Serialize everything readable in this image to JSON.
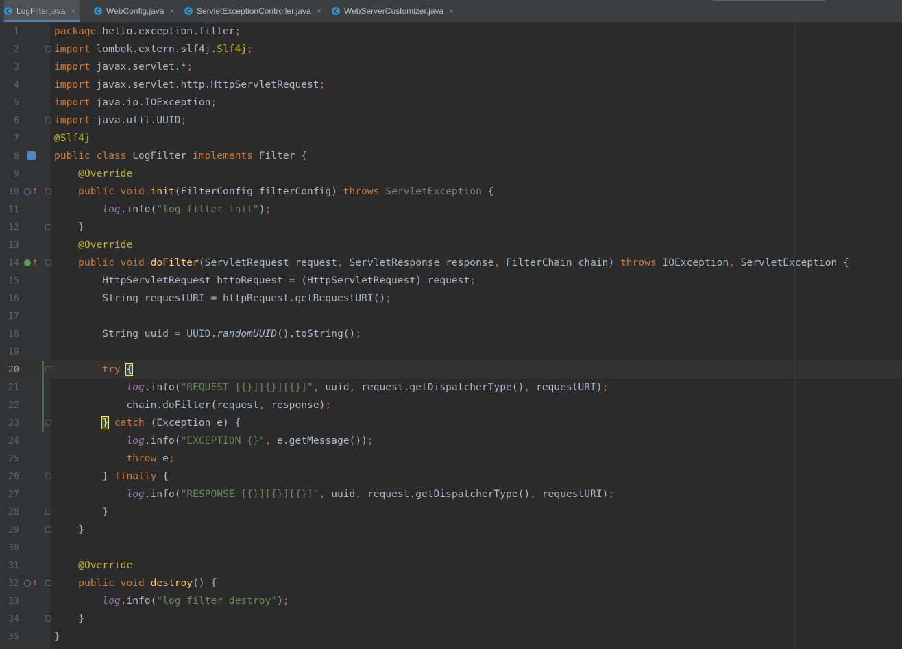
{
  "tabs": [
    {
      "label": "LogFilter.java",
      "active": true
    },
    {
      "label": "WebConfig.java",
      "active": false
    },
    {
      "label": "ServletExceptionController.java",
      "active": false
    },
    {
      "label": "WebServerCustomizer.java",
      "active": false
    }
  ],
  "tab_icon_letter": "C",
  "tab_close_glyph": "×",
  "current_line": 20,
  "colors": {
    "keyword": "#cc7832",
    "annotation": "#bbb529",
    "string": "#6a8759",
    "method": "#ffc66d",
    "field": "#9876aa",
    "default_text": "#a9b7c6",
    "background": "#2b2b2b",
    "gutter": "#313335"
  },
  "code_lines": [
    {
      "n": "1",
      "tokens": [
        [
          "k",
          "package"
        ],
        [
          "t",
          " hello.exception.filter"
        ],
        [
          "k",
          ";"
        ]
      ]
    },
    {
      "n": "2",
      "tokens": [
        [
          "k",
          "import"
        ],
        [
          "t",
          " lombok.extern.slf4j."
        ],
        [
          "ann",
          "Slf4j"
        ],
        [
          "k",
          ";"
        ]
      ]
    },
    {
      "n": "3",
      "tokens": [
        [
          "k",
          "import"
        ],
        [
          "t",
          " javax.servlet.*"
        ],
        [
          "k",
          ";"
        ]
      ]
    },
    {
      "n": "4",
      "tokens": [
        [
          "k",
          "import"
        ],
        [
          "t",
          " javax.servlet.http.HttpServletRequest"
        ],
        [
          "k",
          ";"
        ]
      ]
    },
    {
      "n": "5",
      "tokens": [
        [
          "k",
          "import"
        ],
        [
          "t",
          " java.io.IOException"
        ],
        [
          "k",
          ";"
        ]
      ]
    },
    {
      "n": "6",
      "tokens": [
        [
          "k",
          "import"
        ],
        [
          "t",
          " java.util.UUID"
        ],
        [
          "k",
          ";"
        ]
      ]
    },
    {
      "n": "7",
      "tokens": [
        [
          "ann",
          "@Slf4j"
        ]
      ]
    },
    {
      "n": "8",
      "tokens": [
        [
          "k",
          "public class "
        ],
        [
          "t",
          "LogFilter "
        ],
        [
          "k",
          "implements "
        ],
        [
          "t",
          "Filter {"
        ]
      ]
    },
    {
      "n": "9",
      "tokens": [
        [
          "t",
          "    "
        ],
        [
          "ann",
          "@Override"
        ]
      ]
    },
    {
      "n": "10",
      "tokens": [
        [
          "t",
          "    "
        ],
        [
          "k",
          "public void "
        ],
        [
          "fn",
          "init"
        ],
        [
          "t",
          "(FilterConfig filterConfig) "
        ],
        [
          "k",
          "throws "
        ],
        [
          "gray",
          "ServletException"
        ],
        [
          "t",
          " {"
        ]
      ]
    },
    {
      "n": "11",
      "tokens": [
        [
          "t",
          "        "
        ],
        [
          "fld",
          "log"
        ],
        [
          "t",
          ".info("
        ],
        [
          "str",
          "\"log filter init\""
        ],
        [
          "t",
          ")"
        ],
        [
          "k",
          ";"
        ]
      ]
    },
    {
      "n": "12",
      "tokens": [
        [
          "t",
          "    }"
        ]
      ]
    },
    {
      "n": "13",
      "tokens": [
        [
          "t",
          "    "
        ],
        [
          "ann",
          "@Override"
        ]
      ]
    },
    {
      "n": "14",
      "tokens": [
        [
          "t",
          "    "
        ],
        [
          "k",
          "public void "
        ],
        [
          "fn",
          "doFilter"
        ],
        [
          "t",
          "(ServletRequest request"
        ],
        [
          "k",
          ", "
        ],
        [
          "t",
          "ServletResponse response"
        ],
        [
          "k",
          ", "
        ],
        [
          "t",
          "FilterChain chain) "
        ],
        [
          "k",
          "throws "
        ],
        [
          "t",
          "IOException"
        ],
        [
          "k",
          ", "
        ],
        [
          "t",
          "ServletException {"
        ]
      ]
    },
    {
      "n": "15",
      "tokens": [
        [
          "t",
          "        HttpServletRequest httpRequest = (HttpServletRequest) request"
        ],
        [
          "k",
          ";"
        ]
      ]
    },
    {
      "n": "16",
      "tokens": [
        [
          "t",
          "        String requestURI = httpRequest.getRequestURI()"
        ],
        [
          "k",
          ";"
        ]
      ]
    },
    {
      "n": "17",
      "tokens": []
    },
    {
      "n": "18",
      "tokens": [
        [
          "t",
          "        String uuid = UUID."
        ],
        [
          "it",
          "randomUUID"
        ],
        [
          "t",
          "().toString()"
        ],
        [
          "k",
          ";"
        ]
      ]
    },
    {
      "n": "19",
      "tokens": []
    },
    {
      "n": "20",
      "tokens": [
        [
          "t",
          "        "
        ],
        [
          "k",
          "try "
        ],
        [
          "brk",
          "{"
        ]
      ]
    },
    {
      "n": "21",
      "tokens": [
        [
          "t",
          "            "
        ],
        [
          "fld",
          "log"
        ],
        [
          "t",
          ".info("
        ],
        [
          "str",
          "\"REQUEST [{}][{}][{}]\""
        ],
        [
          "k",
          ", "
        ],
        [
          "t",
          "uuid"
        ],
        [
          "k",
          ", "
        ],
        [
          "t",
          "request.getDispatcherType()"
        ],
        [
          "k",
          ", "
        ],
        [
          "t",
          "requestURI)"
        ],
        [
          "k",
          ";"
        ]
      ]
    },
    {
      "n": "22",
      "tokens": [
        [
          "t",
          "            chain.doFilter(request"
        ],
        [
          "k",
          ", "
        ],
        [
          "t",
          "response)"
        ],
        [
          "k",
          ";"
        ]
      ]
    },
    {
      "n": "23",
      "tokens": [
        [
          "t",
          "        "
        ],
        [
          "brk",
          "}"
        ],
        [
          "k",
          " catch "
        ],
        [
          "t",
          "(Exception e) {"
        ]
      ]
    },
    {
      "n": "24",
      "tokens": [
        [
          "t",
          "            "
        ],
        [
          "fld",
          "log"
        ],
        [
          "t",
          ".info("
        ],
        [
          "str",
          "\"EXCEPTION {}\""
        ],
        [
          "k",
          ", "
        ],
        [
          "t",
          "e.getMessage())"
        ],
        [
          "k",
          ";"
        ]
      ]
    },
    {
      "n": "25",
      "tokens": [
        [
          "t",
          "            "
        ],
        [
          "k",
          "throw "
        ],
        [
          "t",
          "e"
        ],
        [
          "k",
          ";"
        ]
      ]
    },
    {
      "n": "26",
      "tokens": [
        [
          "t",
          "        } "
        ],
        [
          "k",
          "finally "
        ],
        [
          "t",
          "{"
        ]
      ]
    },
    {
      "n": "27",
      "tokens": [
        [
          "t",
          "            "
        ],
        [
          "fld",
          "log"
        ],
        [
          "t",
          ".info("
        ],
        [
          "str",
          "\"RESPONSE [{}][{}][{}]\""
        ],
        [
          "k",
          ", "
        ],
        [
          "t",
          "uuid"
        ],
        [
          "k",
          ", "
        ],
        [
          "t",
          "request.getDispatcherType()"
        ],
        [
          "k",
          ", "
        ],
        [
          "t",
          "requestURI)"
        ],
        [
          "k",
          ";"
        ]
      ]
    },
    {
      "n": "28",
      "tokens": [
        [
          "t",
          "        }"
        ]
      ]
    },
    {
      "n": "29",
      "tokens": [
        [
          "t",
          "    }"
        ]
      ]
    },
    {
      "n": "30",
      "tokens": []
    },
    {
      "n": "31",
      "tokens": [
        [
          "t",
          "    "
        ],
        [
          "ann",
          "@Override"
        ]
      ]
    },
    {
      "n": "32",
      "tokens": [
        [
          "t",
          "    "
        ],
        [
          "k",
          "public void "
        ],
        [
          "fn",
          "destroy"
        ],
        [
          "t",
          "() {"
        ]
      ]
    },
    {
      "n": "33",
      "tokens": [
        [
          "t",
          "        "
        ],
        [
          "fld",
          "log"
        ],
        [
          "t",
          ".info("
        ],
        [
          "str",
          "\"log filter destroy\""
        ],
        [
          "t",
          ")"
        ],
        [
          "k",
          ";"
        ]
      ]
    },
    {
      "n": "34",
      "tokens": [
        [
          "t",
          "    }"
        ]
      ]
    },
    {
      "n": "35",
      "tokens": [
        [
          "t",
          "}"
        ]
      ]
    }
  ],
  "fold_markers": [
    "2",
    "6",
    "10",
    "12",
    "14",
    "20",
    "23",
    "26",
    "28",
    "29",
    "32",
    "34"
  ],
  "override_markers": [
    {
      "line": "10",
      "kind": "override-up-icon"
    },
    {
      "line": "14",
      "kind": "implement-up-icon"
    },
    {
      "line": "32",
      "kind": "override-up-icon"
    }
  ],
  "implementation_marker_line": "8"
}
